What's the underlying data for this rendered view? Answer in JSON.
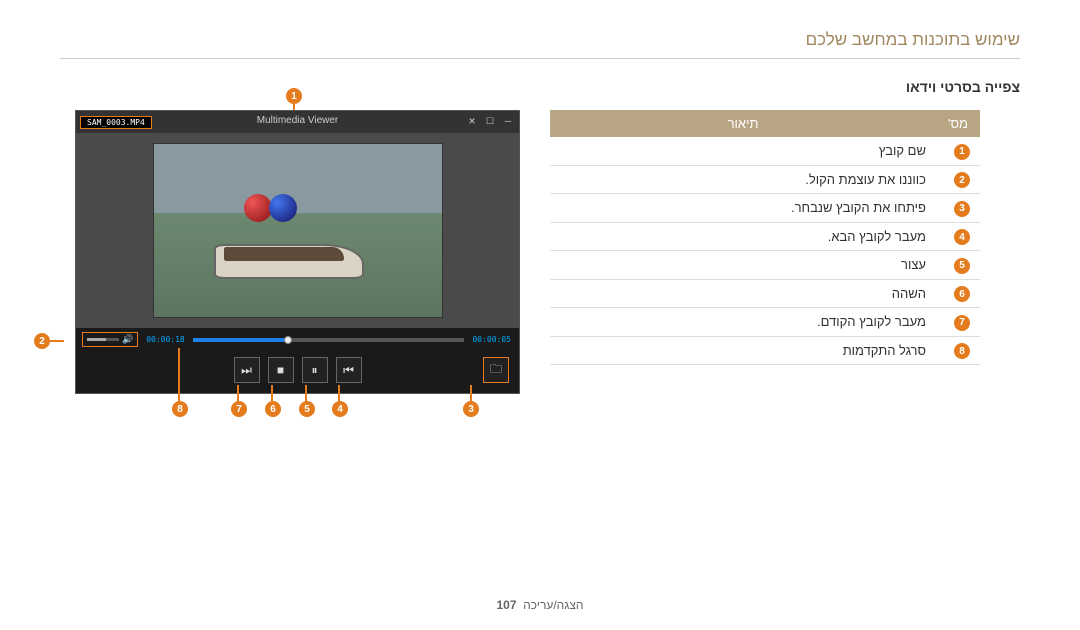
{
  "header": {
    "title": "שימוש בתוכנות במחשב שלכם"
  },
  "section": {
    "title": "צפייה בסרטי וידאו"
  },
  "player": {
    "filename": "SAM_0003.MP4",
    "window_title": "Multimedia Viewer",
    "time_current": "00:00:05",
    "time_total": "00:00:18",
    "controls": {
      "prev_glyph": "⏮",
      "pause_glyph": "⏸",
      "stop_glyph": "■",
      "next_glyph": "⏭",
      "folder_glyph": "🗀"
    }
  },
  "callouts": [
    "1",
    "2",
    "3",
    "4",
    "5",
    "6",
    "7",
    "8"
  ],
  "table": {
    "head_num": "מס'",
    "head_desc": "תיאור",
    "rows": [
      {
        "n": "1",
        "d": "שם קובץ"
      },
      {
        "n": "2",
        "d": "כווננו את עוצמת הקול."
      },
      {
        "n": "3",
        "d": "פיתחו את הקובץ שנבחר."
      },
      {
        "n": "4",
        "d": "מעבר לקובץ הבא."
      },
      {
        "n": "5",
        "d": "עצור"
      },
      {
        "n": "6",
        "d": "השהה"
      },
      {
        "n": "7",
        "d": "מעבר לקובץ הקודם."
      },
      {
        "n": "8",
        "d": "סרגל התקדמות"
      }
    ]
  },
  "footer": {
    "text": "הצגה/עריכה",
    "page": "107"
  }
}
